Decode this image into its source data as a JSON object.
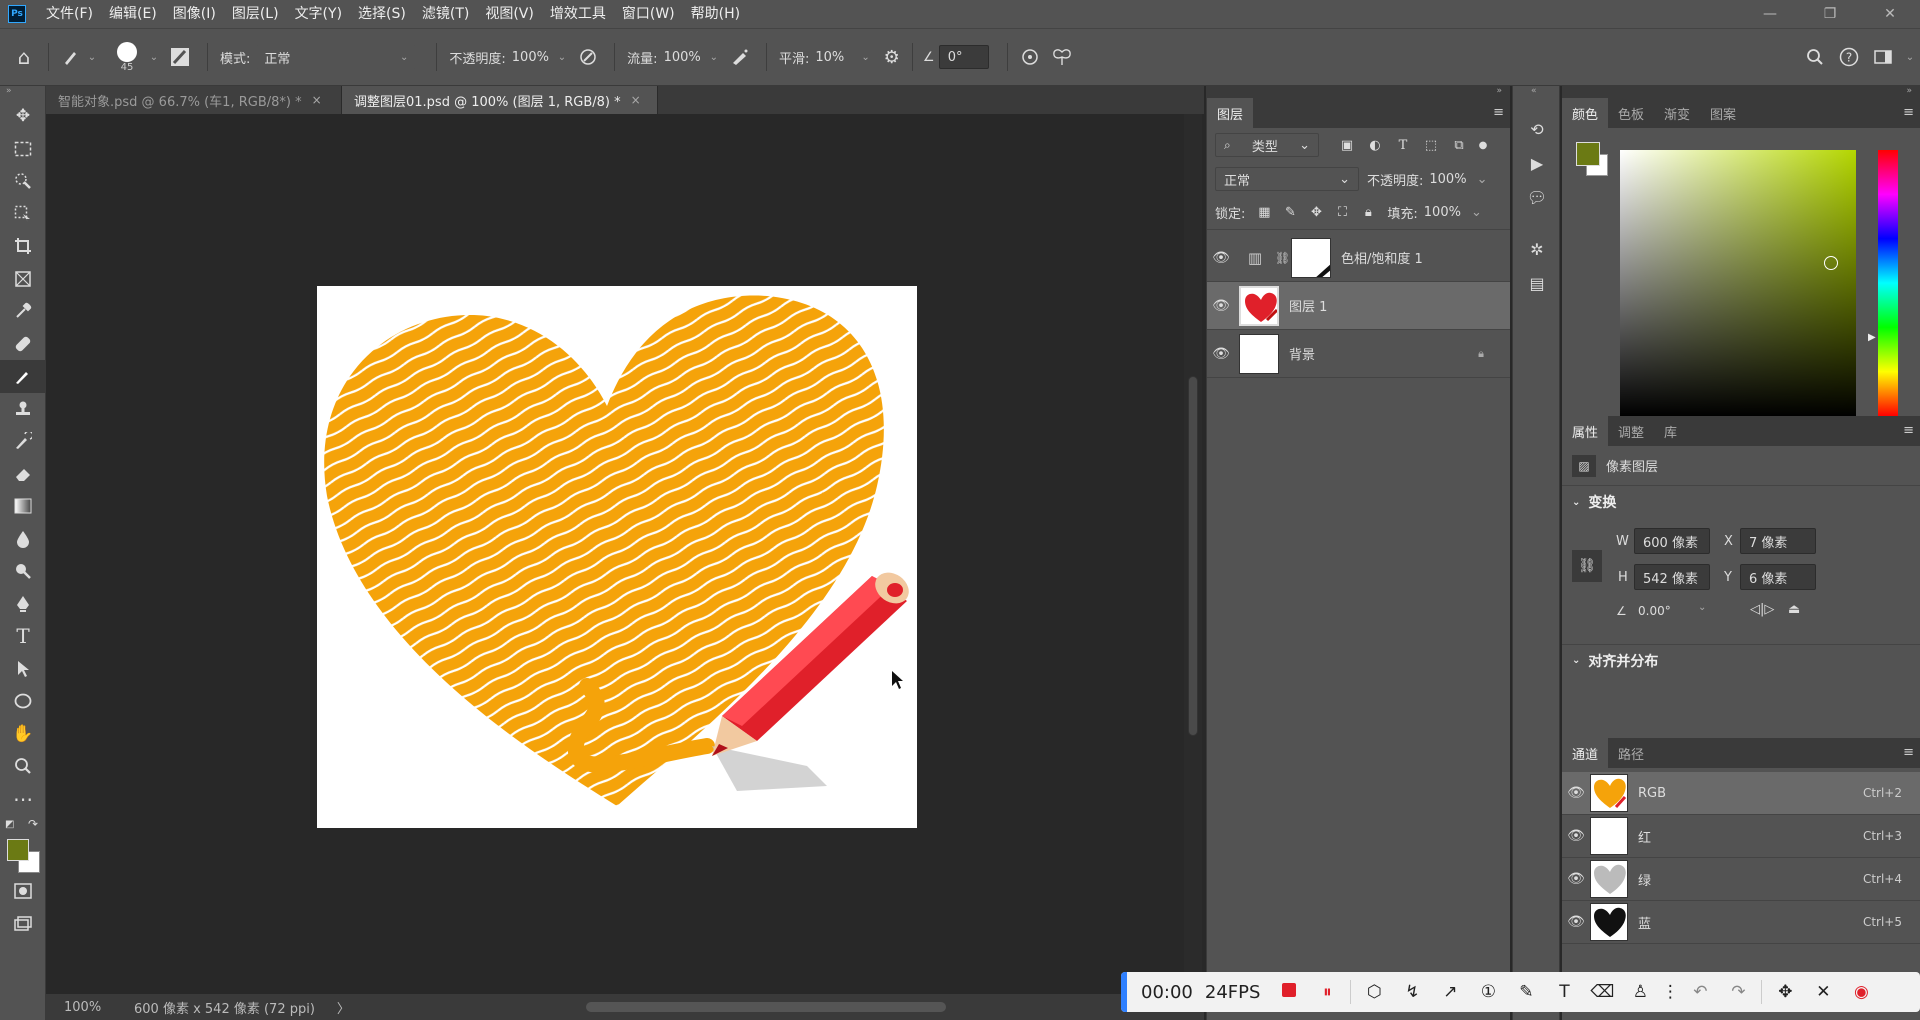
{
  "menubar": {
    "logo": "Ps",
    "items": [
      "文件(F)",
      "编辑(E)",
      "图像(I)",
      "图层(L)",
      "文字(Y)",
      "选择(S)",
      "滤镜(T)",
      "视图(V)",
      "增效工具",
      "窗口(W)",
      "帮助(H)"
    ],
    "window_controls": [
      "—",
      "❐",
      "✕"
    ]
  },
  "options": {
    "brush_size": "45",
    "mode_label": "模式:",
    "mode_value": "正常",
    "opacity_label": "不透明度:",
    "opacity_value": "100%",
    "flow_label": "流量:",
    "flow_value": "100%",
    "smooth_label": "平滑:",
    "smooth_value": "10%",
    "angle_value": "0°"
  },
  "tabs": [
    {
      "label": "智能对象.psd @ 66.7% (车1, RGB/8*) *",
      "close": "×"
    },
    {
      "label": "调整图层01.psd @ 100% (图层 1, RGB/8) *",
      "close": "×"
    }
  ],
  "status": {
    "zoom": "100%",
    "doc_info": "600 像素 x 542 像素 (72 ppi)",
    "arrow": "〉"
  },
  "layers_panel": {
    "tab": "图层",
    "filter_label": "类型",
    "blend_mode": "正常",
    "opacity_label": "不透明度:",
    "opacity_value": "100%",
    "lock_label": "锁定:",
    "fill_label": "填充:",
    "fill_value": "100%",
    "layers": [
      {
        "name": "色相/饱和度 1"
      },
      {
        "name": "图层 1"
      },
      {
        "name": "背景"
      }
    ]
  },
  "color_panel": {
    "tabs": [
      "颜色",
      "色板",
      "渐变",
      "图案"
    ],
    "foreground": "#6b7a14",
    "background": "#ffffff"
  },
  "properties_panel": {
    "tabs": [
      "属性",
      "调整",
      "库"
    ],
    "type_label": "像素图层",
    "transform_title": "变换",
    "w_label": "W",
    "w_value": "600 像素",
    "h_label": "H",
    "h_value": "542 像素",
    "x_label": "X",
    "x_value": "7 像素",
    "y_label": "Y",
    "y_value": "6 像素",
    "angle_value": "0.00°",
    "align_title": "对齐并分布"
  },
  "channels_panel": {
    "tabs": [
      "通道",
      "路径"
    ],
    "channels": [
      {
        "name": "RGB",
        "shortcut": "Ctrl+2"
      },
      {
        "name": "红",
        "shortcut": "Ctrl+3"
      },
      {
        "name": "绿",
        "shortcut": "Ctrl+4"
      },
      {
        "name": "蓝",
        "shortcut": "Ctrl+5"
      }
    ]
  },
  "recorder": {
    "time": "00:00",
    "fps": "24FPS"
  },
  "colors": {
    "heart": "#f5a30a",
    "pencil": "#e0202a"
  }
}
